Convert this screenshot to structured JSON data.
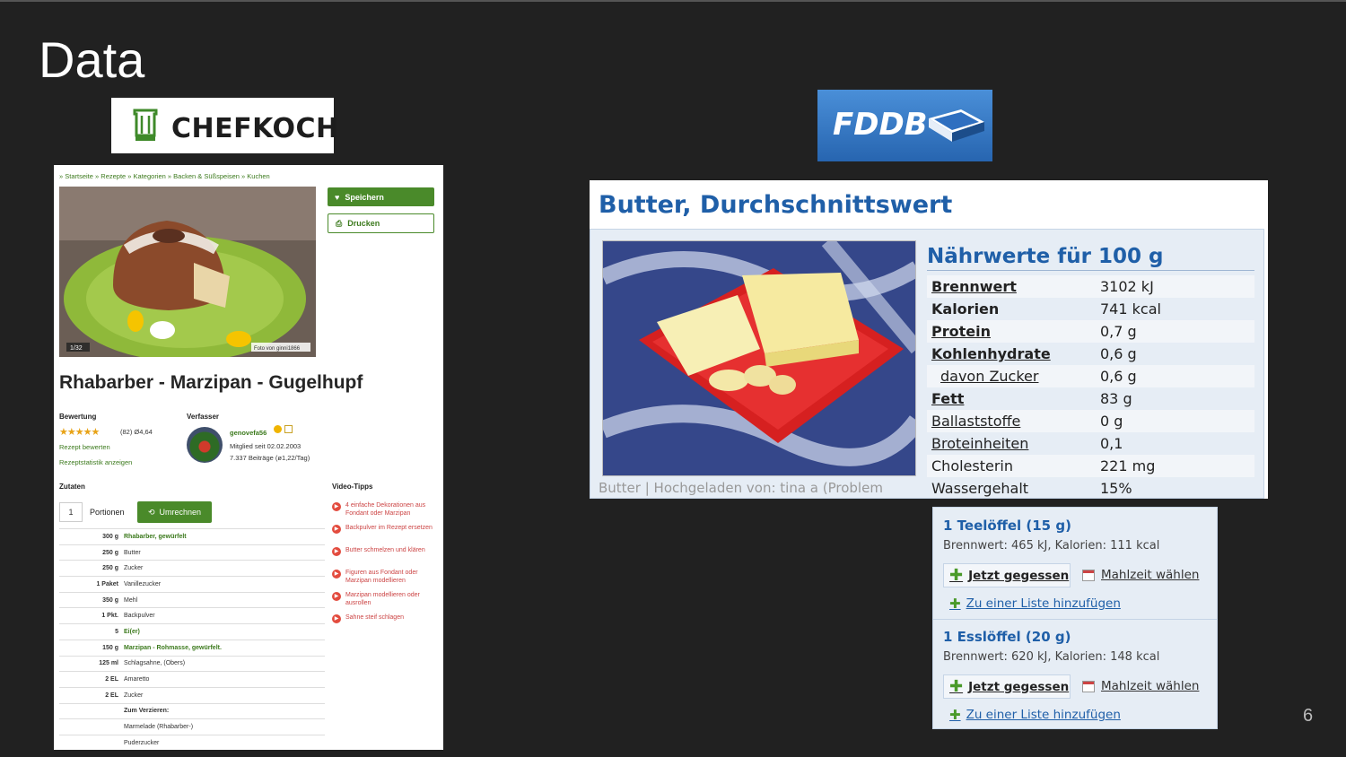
{
  "slide": {
    "title": "Data",
    "page_number": "6"
  },
  "chefkoch": {
    "logo_text": "CHEFKOCH",
    "breadcrumb": "» Startseite » Rezepte » Kategorien » Backen & Süßspeisen » Kuchen",
    "save_label": "Speichern",
    "print_label": "Drucken",
    "photo_counter": "1/32",
    "photo_credit": "Foto von ginni1866",
    "recipe_title": "Rhabarber - Marzipan - Gugelhupf",
    "rating_label": "Bewertung",
    "rating_stars": "★★★★★",
    "rating_text": "(82) Ø4,64",
    "rate_link": "Rezept bewerten",
    "stats_link": "Rezeptstatistik anzeigen",
    "author_label": "Verfasser",
    "author_name": "genovefa56",
    "member_since": "Mitglied seit 02.02.2003",
    "posts": "7.337 Beiträge (ø1,22/Tag)",
    "ingredients_label": "Zutaten",
    "portions_value": "1",
    "portions_label": "Portionen",
    "convert_label": "Umrechnen",
    "ingredients": [
      {
        "amount": "300 g",
        "name": "Rhabarber, gewürfelt",
        "style": "hl"
      },
      {
        "amount": "250 g",
        "name": "Butter",
        "style": ""
      },
      {
        "amount": "250 g",
        "name": "Zucker",
        "style": ""
      },
      {
        "amount": "1 Paket",
        "name": "Vanillezucker",
        "style": ""
      },
      {
        "amount": "350 g",
        "name": "Mehl",
        "style": ""
      },
      {
        "amount": "1 Pkt.",
        "name": "Backpulver",
        "style": ""
      },
      {
        "amount": "5",
        "name": "Ei(er)",
        "style": "hl"
      },
      {
        "amount": "150 g",
        "name": "Marzipan - Rohmasse, gewürfelt.",
        "style": "hl"
      },
      {
        "amount": "125 ml",
        "name": "Schlagsahne, (Obers)",
        "style": ""
      },
      {
        "amount": "2 EL",
        "name": "Amaretto",
        "style": ""
      },
      {
        "amount": "2 EL",
        "name": "Zucker",
        "style": ""
      },
      {
        "amount": "",
        "name": "Zum Verzieren:",
        "style": "bold"
      },
      {
        "amount": "",
        "name": "Marmelade (Rhabarber-)",
        "style": ""
      },
      {
        "amount": "",
        "name": "Puderzucker",
        "style": ""
      }
    ],
    "video_label": "Video-Tipps",
    "videos": [
      "4 einfache Dekorationen aus Fondant oder Marzipan",
      "Backpulver im Rezept ersetzen",
      "Butter schmelzen und klären",
      "Figuren aus Fondant oder Marzipan modellieren",
      "Marzipan modellieren oder ausrollen",
      "Sahne steif schlagen"
    ]
  },
  "fddb": {
    "logo_text": "FDDB",
    "title": "Butter, Durchschnittswert",
    "caption": "Butter | Hochgeladen von: tina a (Problem",
    "nutrition_heading": "Nährwerte für 100 g",
    "nutrients": [
      {
        "name": "Brennwert",
        "value": "3102 kJ",
        "style": "bu"
      },
      {
        "name": "Kalorien",
        "value": "741 kcal",
        "style": "b"
      },
      {
        "name": "Protein",
        "value": "0,7 g",
        "style": "bu"
      },
      {
        "name": "Kohlenhydrate",
        "value": "0,6 g",
        "style": "bu"
      },
      {
        "name": "davon Zucker",
        "value": "0,6 g",
        "style": "ind"
      },
      {
        "name": "Fett",
        "value": "83 g",
        "style": "bu"
      },
      {
        "name": "Ballaststoffe",
        "value": "0 g",
        "style": "u"
      },
      {
        "name": "Broteinheiten",
        "value": "0,1",
        "style": "u"
      },
      {
        "name": "Cholesterin",
        "value": "221 mg",
        "style": ""
      },
      {
        "name": "Wassergehalt",
        "value": "15%",
        "style": ""
      }
    ],
    "portions": [
      {
        "heading": "1 Teelöffel (15 g)",
        "values": "Brennwert: 465 kJ, Kalorien: 111 kcal",
        "eat": "Jetzt gegessen",
        "meal": "Mahlzeit wählen",
        "list": "Zu einer Liste hinzufügen"
      },
      {
        "heading": "1 Esslöffel (20 g)",
        "values": "Brennwert: 620 kJ, Kalorien: 148 kcal",
        "eat": "Jetzt gegessen",
        "meal": "Mahlzeit wählen",
        "list": "Zu einer Liste hinzufügen"
      }
    ]
  }
}
